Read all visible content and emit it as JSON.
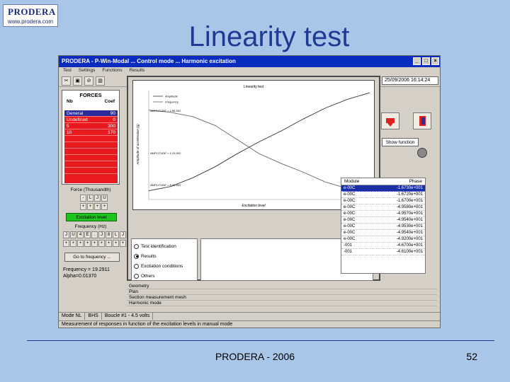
{
  "logo": {
    "name": "PRODERA",
    "url": "www.prodera.com"
  },
  "slide": {
    "title": "Linearity test",
    "footer": "PRODERA - 2006",
    "page_number": "52"
  },
  "app": {
    "window_title": "PRODERA - P-Win-Modal ... Control mode ... Harmonic excitation",
    "menu": [
      "Test",
      "Settings",
      "Functions",
      "Results"
    ],
    "datetime": "25/09/2006 16:14:24",
    "window_buttons": [
      "_",
      "□",
      "×"
    ]
  },
  "forces": {
    "title": "FORCES",
    "col_nb": "Nb",
    "col_coef": "Coef",
    "rows": [
      {
        "nb": "General",
        "coef": "90"
      },
      {
        "nb": "Undefined",
        "coef": "0"
      },
      {
        "nb": "5",
        "coef": "300"
      },
      {
        "nb": "10",
        "coef": "170"
      }
    ]
  },
  "controls": {
    "force_label": "Force (Thousandth)",
    "green_button": "Excitation level",
    "frequency_label": "Frequency (Hz)",
    "go_freq": "Go to frequency ...",
    "frequency_value": "Frequency = 19.2911",
    "alpha_value": "Alpha=0.01370"
  },
  "popup": {
    "radios": [
      {
        "label": "Test identification",
        "checked": false
      },
      {
        "label": "Results",
        "checked": true
      },
      {
        "label": "Excitation conditions",
        "checked": false
      },
      {
        "label": "Others",
        "checked": false
      }
    ]
  },
  "right_panel": {
    "show_function": "Show function",
    "col_module": "Module",
    "col_phase": "Phase",
    "rows": [
      {
        "a": "e-00C",
        "b": "-1.6730e+001",
        "selected": true
      },
      {
        "a": "e-00C",
        "b": "-1.6720e+001",
        "selected": false
      },
      {
        "a": "e-00C",
        "b": "-1.6700e+001",
        "selected": false
      },
      {
        "a": "e-00C",
        "b": "-4.9580e+001",
        "selected": false
      },
      {
        "a": "e-00C",
        "b": "-4.9570e+001",
        "selected": false
      },
      {
        "a": "e-00C",
        "b": "-4.9540e+001",
        "selected": false
      },
      {
        "a": "e-00C",
        "b": "-4.9530e+001",
        "selected": false
      },
      {
        "a": "e-00C",
        "b": "-4.9540e+001",
        "selected": false
      },
      {
        "a": "e-00C",
        "b": "-4.9200e+001",
        "selected": false
      },
      {
        "a": "-001",
        "b": "-4.6700e+001",
        "selected": false
      },
      {
        "a": "-001",
        "b": "-4.6100e+001",
        "selected": false
      }
    ]
  },
  "status": {
    "rows": [
      "Geometry",
      "Plan",
      "Section measurement mesh",
      "Harmonic mode"
    ],
    "mode_items": [
      "Mode NL",
      "BHS",
      "Boucle #1 - 4.5 volts"
    ],
    "status_line": "Measurement of responses in function of the excitation levels in manual mode"
  },
  "chart_data": {
    "type": "line",
    "title": "Linearity test",
    "xlabel": "Excitation level",
    "ylabel": "Amplitude of acceleration (g)",
    "x": [
      0,
      1,
      2,
      3,
      4,
      5,
      6,
      7,
      8,
      9,
      10
    ],
    "series": [
      {
        "name": "Amplitude",
        "values": [
          0.08,
          0.12,
          0.2,
          0.3,
          0.42,
          0.53,
          0.63,
          0.74,
          0.84,
          0.92,
          0.98
        ]
      },
      {
        "name": "Frequency",
        "values": [
          0.82,
          0.8,
          0.76,
          0.68,
          0.55,
          0.42,
          0.33,
          0.25,
          0.16,
          0.1,
          0.1
        ]
      }
    ],
    "ylim": [
      0,
      1
    ],
    "annotations": [
      "AMPLITUDE = 1.88-002",
      "AMPLITUDE = 1.23-002",
      "AMPLITUDE = 8.41-003"
    ]
  }
}
